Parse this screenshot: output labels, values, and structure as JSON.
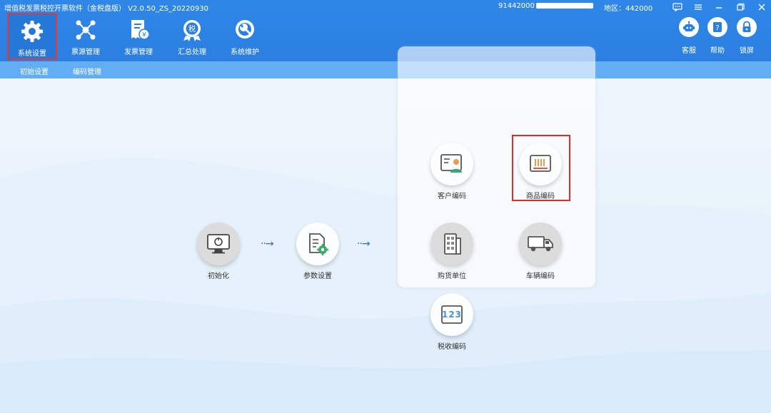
{
  "window": {
    "title": "增值税发票税控开票软件（金税盘版） V2.0.50_ZS_20220930",
    "tax_id_prefix": "91442000",
    "region_label": "地区：442000",
    "controls": [
      "message-icon",
      "menu-icon",
      "minimize-icon",
      "restore-icon",
      "close-icon"
    ]
  },
  "menu": {
    "items": [
      {
        "label": "系统设置",
        "icon": "gear-icon",
        "active": true
      },
      {
        "label": "票源管理",
        "icon": "network-icon"
      },
      {
        "label": "发票管理",
        "icon": "invoice-icon"
      },
      {
        "label": "汇总处理",
        "icon": "tax-summary-icon"
      },
      {
        "label": "系统维护",
        "icon": "wrench-icon"
      }
    ],
    "right": [
      {
        "label": "客服",
        "icon": "robot-icon"
      },
      {
        "label": "帮助",
        "icon": "help-icon"
      },
      {
        "label": "锁屏",
        "icon": "lock-icon"
      }
    ]
  },
  "subnav": {
    "items": [
      {
        "label": "初始设置"
      },
      {
        "label": "编码管理"
      }
    ]
  },
  "flow": {
    "init": {
      "label": "初始化",
      "icon": "monitor-icon"
    },
    "params": {
      "label": "参数设置",
      "icon": "document-gear-icon"
    },
    "arrow": "··→"
  },
  "codes": {
    "customer": {
      "label": "客户编码",
      "icon": "id-card-icon"
    },
    "product": {
      "label": "商品编码",
      "icon": "barcode-icon"
    },
    "buyer": {
      "label": "购货单位",
      "icon": "building-icon"
    },
    "vehicle": {
      "label": "车辆编码",
      "icon": "truck-icon"
    },
    "tax": {
      "label": "税收编码",
      "icon": "numbers-icon",
      "digits": "123"
    }
  },
  "colors": {
    "topbar": "#2f87e8",
    "subbar": "#62aef5",
    "highlight": "#d32f2f"
  }
}
